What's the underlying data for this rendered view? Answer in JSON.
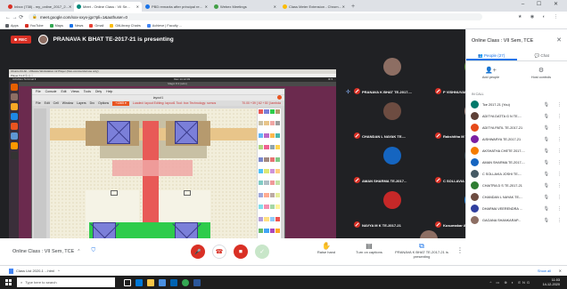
{
  "browser": {
    "tabs": [
      {
        "label": "Inbox (738) - my_online_2017_2...",
        "color": "#d93025"
      },
      {
        "label": "Meet - Online Class : VII Se...",
        "color": "#00897b",
        "active": true
      },
      {
        "label": "PBD remarks after principal re...",
        "color": "#1a73e8"
      },
      {
        "label": "Webex Meetings",
        "color": "#43a047"
      },
      {
        "label": "Class Meter Extension - Chrom...",
        "color": "#fbbc04"
      }
    ],
    "newtab": "+",
    "winctl": "–  ☐  ✕",
    "url": "meet.google.com/xxx-xxyx-jgx?pli=1&authuser=0",
    "nav": "←  →  ⟳",
    "addr_icons": "★  ◉  ◐  ⋮",
    "bookmarks": [
      {
        "label": "Apps",
        "color": "#5f6368"
      },
      {
        "label": "YouTube",
        "color": "#d93025"
      },
      {
        "label": "Maps",
        "color": "#34a853"
      },
      {
        "label": "News",
        "color": "#1a73e8"
      },
      {
        "label": "Gmail",
        "color": "#ea4335"
      },
      {
        "label": "GitLibrary Chairs",
        "color": "#fbbc04"
      },
      {
        "label": "Achieve | Faculty ...",
        "color": "#4285f4"
      }
    ]
  },
  "meet": {
    "rec_label": "REC",
    "presenting": "PRANAVA K BHAT TE-2017-21 is presenting",
    "screen": {
      "vm_title": "Ubuntu 64-bit - VMware Workstation 12 Player (Non-commercial use only)",
      "vm_menu": "Player ▾  ⏸ ▾  ⎘  ⎙  ⛶",
      "top_left": "Activities     Terminal ▾",
      "top_center": "Dec 14 12:03",
      "top_right": "⚙ ▾",
      "mag_title": "Magic 8.3 (sdm)",
      "mw_menu": [
        "File",
        "Console",
        "Edit",
        "Views",
        "Tools",
        "Dirty",
        "Help"
      ],
      "layout_title": "layout1",
      "layout_menu": [
        "File",
        "Edit",
        "Cell",
        "Window",
        "Layers",
        "Drc",
        "Options"
      ],
      "tech": "+1365 ▾",
      "tech_info": "Loaded: layout Editing: layout1 Tool: box Technology: scmos",
      "coord": "70.00 +39 [ 62 +30 ] lambda"
    },
    "tiles": [
      {
        "name": "PRANAVA K BHAT TE-2017-...",
        "avatar": "#8d6e63",
        "pinned": true
      },
      {
        "name": "P VISHNUVARDHAN RE...",
        "avatar": "#558b2f"
      },
      {
        "name": "CHANDAN L NAYAK TE-...",
        "avatar": "#6d4c41"
      },
      {
        "name": "Rakshitha M TCE 2017-...",
        "avatar": "#a1887f"
      },
      {
        "name": "AMAN SHARMA TE-2017...",
        "avatar": "#1565c0"
      },
      {
        "name": "C SOLLAVIA JOSHI TE...",
        "avatar": "#37474f"
      },
      {
        "name": "NAVYA M K TE-2017-21",
        "avatar": "#c62828"
      },
      {
        "name": "Kusumakar A Patil TCE...",
        "avatar": "#1e88e5"
      }
    ],
    "self_tile": {
      "name": "PRANAVA K BHAT TE-2017-21 is presenting"
    }
  },
  "controls": {
    "meeting_title": "Online Class : VII Sem, TCE",
    "chevron": "⌃",
    "shield": "⛉",
    "raise_hand": "Raise hand",
    "captions": "Turn on captions",
    "presenting": "PRANAVA K BHAT TE-2017-21 is presenting",
    "raise_icon": "✋",
    "cc_icon": "▤",
    "present_icon": "⧉",
    "more": "⋮",
    "mic_icon": "🎤",
    "hangup_icon": "☎",
    "cam_icon": "◼",
    "check_icon": "✓"
  },
  "panel": {
    "title": "Online Class : VII Sem, TCE",
    "close": "✕",
    "tab_people": "People (27)",
    "tab_chat": "Chat",
    "add_people": "Add people",
    "host_controls": "Host controls",
    "add_icon": "👤+",
    "host_icon": "⚙",
    "in_call": "IN CALL",
    "mic_icon": "🎙",
    "more_icon": "⋮",
    "people": [
      {
        "name": "Tce 2017-21 (You)",
        "color": "#00796b"
      },
      {
        "name": "ADITYA DATTA G N TE-...",
        "color": "#5d4037"
      },
      {
        "name": "ADITYA PATIL TE-2017-21",
        "color": "#e64a19"
      },
      {
        "name": "AISHWARYA TE-2017-21",
        "color": "#7b1fa2"
      },
      {
        "name": "AKSHATHA CHETE 2017-...",
        "color": "#f57c00"
      },
      {
        "name": "AMAN SHARMA TE-2017-...",
        "color": "#1565c0"
      },
      {
        "name": "C SOLLAVIA JOSHI TE-...",
        "color": "#455a64"
      },
      {
        "name": "CHAITRA D S TE-2017-21",
        "color": "#2e7d32"
      },
      {
        "name": "CHANDAN L NAYAK TE-...",
        "color": "#6d4c41"
      },
      {
        "name": "DHARMA VEERENDRA ...",
        "color": "#303f9f"
      },
      {
        "name": "GAGANA SHANKARAP...",
        "color": "#8d6e63"
      }
    ]
  },
  "download": {
    "file": "Class List 2020-1 ...html",
    "chevron": "^",
    "show_all": "Show all",
    "close": "✕"
  },
  "taskbar": {
    "search_placeholder": "Type here to search",
    "tray_icons": "^ ▭ ⊕ ◐ ENG",
    "time": "11:03",
    "date": "14-12-2020"
  },
  "colors": {
    "accent": "#1a73e8",
    "danger": "#d93025",
    "green": "#34a853"
  }
}
